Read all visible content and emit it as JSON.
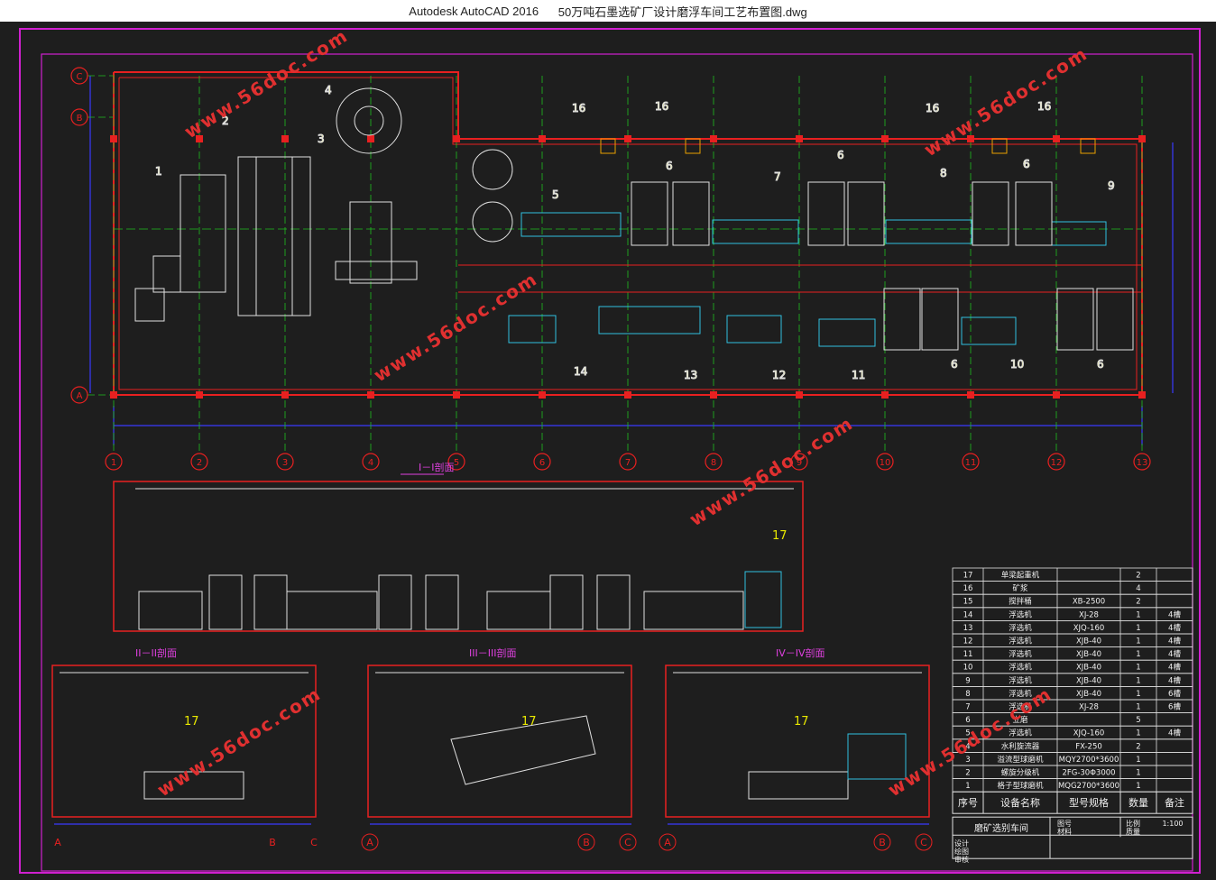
{
  "window": {
    "app": "Autodesk AutoCAD 2016",
    "file": "50万吨石墨选矿厂设计磨浮车间工艺布置图.dwg"
  },
  "axes_h": [
    "1",
    "2",
    "3",
    "4",
    "5",
    "6",
    "7",
    "8",
    "9",
    "10",
    "11",
    "12",
    "13"
  ],
  "axes_v": [
    "C",
    "B",
    "A"
  ],
  "equip_top": [
    "1",
    "2",
    "3",
    "4",
    "5",
    "6",
    "7",
    "6",
    "6",
    "8",
    "6",
    "9",
    "16",
    "16",
    "16",
    "16"
  ],
  "equip_bottom": [
    "14",
    "13",
    "12",
    "11",
    "6",
    "10",
    "6"
  ],
  "sections": {
    "s1": "I－I剖面",
    "s2": "II－II剖面",
    "s3": "III－III剖面",
    "s4": "IV－IV剖面",
    "crane": "17"
  },
  "section_axes": {
    "s2": [
      "A",
      "B",
      "C"
    ],
    "s3": [
      "A",
      "B",
      "C"
    ],
    "s4": [
      "A",
      "B",
      "C"
    ]
  },
  "watermark": "www.56doc.com",
  "table": {
    "rows": [
      {
        "no": "17",
        "name": "单梁起重机",
        "model": "",
        "qty": "2",
        "note": ""
      },
      {
        "no": "16",
        "name": "矿浆",
        "model": "",
        "qty": "4",
        "note": ""
      },
      {
        "no": "15",
        "name": "搅拌桶",
        "model": "XB-2500",
        "qty": "2",
        "note": ""
      },
      {
        "no": "14",
        "name": "浮选机",
        "model": "XJ-28",
        "qty": "1",
        "note": "4槽"
      },
      {
        "no": "13",
        "name": "浮选机",
        "model": "XJQ-160",
        "qty": "1",
        "note": "4槽"
      },
      {
        "no": "12",
        "name": "浮选机",
        "model": "XJB-40",
        "qty": "1",
        "note": "4槽"
      },
      {
        "no": "11",
        "name": "浮选机",
        "model": "XJB-40",
        "qty": "1",
        "note": "4槽"
      },
      {
        "no": "10",
        "name": "浮选机",
        "model": "XJB-40",
        "qty": "1",
        "note": "4槽"
      },
      {
        "no": "9",
        "name": "浮选机",
        "model": "XJB-40",
        "qty": "1",
        "note": "4槽"
      },
      {
        "no": "8",
        "name": "浮选机",
        "model": "XJB-40",
        "qty": "1",
        "note": "6槽"
      },
      {
        "no": "7",
        "name": "浮选机",
        "model": "XJ-28",
        "qty": "1",
        "note": "6槽"
      },
      {
        "no": "6",
        "name": "立磨",
        "model": "",
        "qty": "5",
        "note": ""
      },
      {
        "no": "5",
        "name": "浮选机",
        "model": "XJQ-160",
        "qty": "1",
        "note": "4槽"
      },
      {
        "no": "4",
        "name": "水利旋流器",
        "model": "FX-250",
        "qty": "2",
        "note": ""
      },
      {
        "no": "3",
        "name": "溢流型球磨机",
        "model": "MQY2700*3600",
        "qty": "1",
        "note": ""
      },
      {
        "no": "2",
        "name": "螺旋分级机",
        "model": "2FG-30Φ3000",
        "qty": "1",
        "note": ""
      },
      {
        "no": "1",
        "name": "格子型球磨机",
        "model": "MQG2700*3600",
        "qty": "1",
        "note": ""
      }
    ],
    "header": {
      "no": "序号",
      "name": "设备名称",
      "model": "型号规格",
      "qty": "数量",
      "note": "备注"
    },
    "title_block": {
      "name": "磨矿选别车间",
      "drawing_no": "图号",
      "material": "材料",
      "scale_label": "比例",
      "scale": "1:100",
      "weight": "质量",
      "design": "设计",
      "draw": "绘图",
      "review": "审核"
    }
  }
}
